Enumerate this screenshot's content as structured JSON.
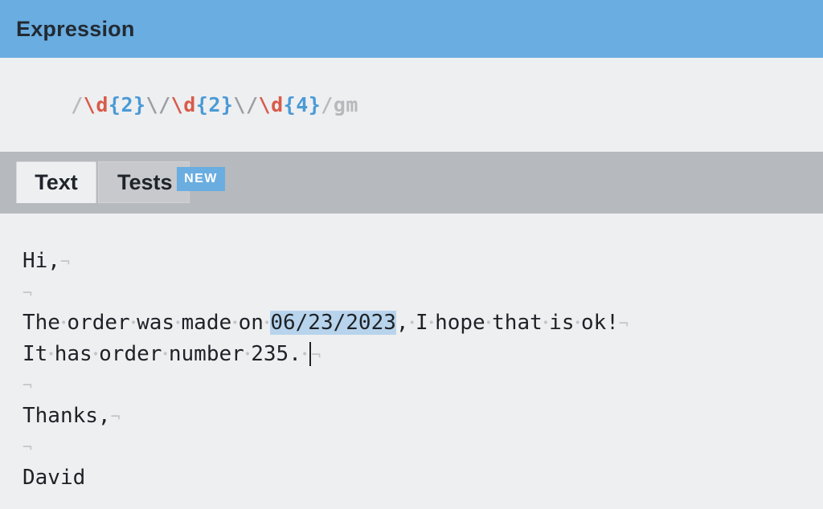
{
  "header": {
    "title": "Expression"
  },
  "expression": {
    "open_delim": "/",
    "tokens": [
      {
        "text": "\\d",
        "kind": "class"
      },
      {
        "text": "{2}",
        "kind": "quant"
      },
      {
        "text": "\\/",
        "kind": "esc"
      },
      {
        "text": "\\d",
        "kind": "class"
      },
      {
        "text": "{2}",
        "kind": "quant"
      },
      {
        "text": "\\/",
        "kind": "esc"
      },
      {
        "text": "\\d",
        "kind": "class"
      },
      {
        "text": "{4}",
        "kind": "quant"
      }
    ],
    "close_delim": "/",
    "flags": "gm"
  },
  "tabs": {
    "text_label": "Text",
    "tests_label": "Tests",
    "tests_badge": "NEW"
  },
  "text": {
    "lines": [
      "Hi,",
      "",
      "The order was made on 06/23/2023, I hope that is ok!",
      "It has order number 235. ",
      "",
      "Thanks,",
      "",
      "David"
    ],
    "match": "06/23/2023",
    "whitespace_marker": "•",
    "newline_marker": "¬"
  },
  "colors": {
    "header_bg": "#6aade0",
    "token_class": "#d85b4a",
    "token_quant": "#4a9ad6",
    "match_highlight": "#b8d4ec"
  }
}
